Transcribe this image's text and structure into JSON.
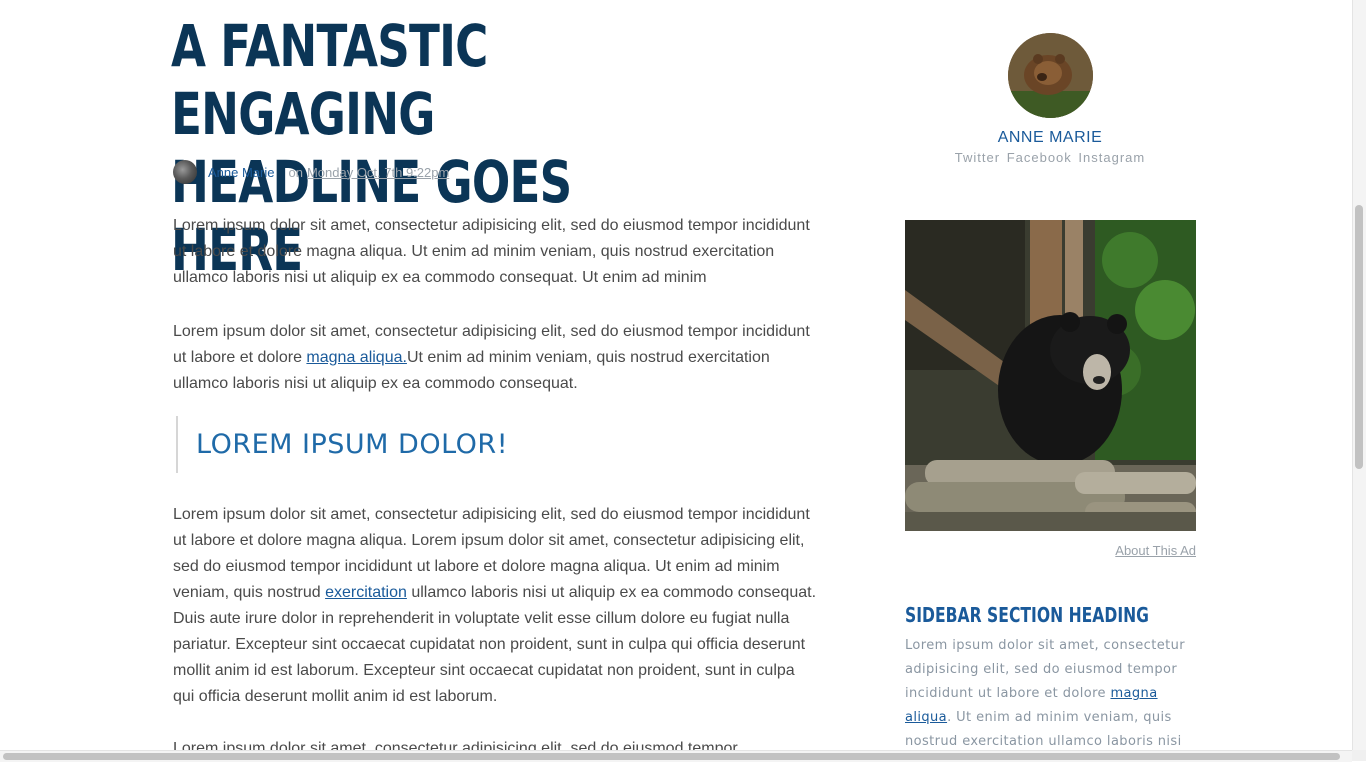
{
  "article": {
    "headline": "A FANTASTIC ENGAGING HEADLINE GOES HERE",
    "author": "Anne Marie",
    "on": "on",
    "date": "Monday Oct. 7th 9:22pm",
    "paragraph1": "Lorem ipsum dolor sit amet, consectetur adipisicing elit, sed do eiusmod tempor incididunt ut labore et dolore magna aliqua. Ut enim ad minim veniam, quis nostrud exercitation ullamco laboris nisi ut aliquip ex ea commodo consequat. Ut enim ad minim",
    "paragraph2": {
      "before": "Lorem ipsum dolor sit amet, consectetur adipisicing elit, sed do eiusmod tempor incididunt ut labore et dolore ",
      "link": "magna aliqua.",
      "after": "Ut enim ad minim veniam, quis nostrud exercitation ullamco laboris nisi ut aliquip ex ea commodo consequat."
    },
    "pullquote": "LOREM IPSUM DOLOR!",
    "paragraph3": {
      "before": "Lorem ipsum dolor sit amet, consectetur adipisicing elit, sed do eiusmod tempor incididunt ut labore et dolore magna aliqua. Lorem ipsum dolor sit amet, consectetur adipisicing elit, sed do eiusmod tempor incididunt ut labore et dolore magna aliqua. Ut enim ad minim veniam, quis nostrud ",
      "link": "exercitation",
      "after": " ullamco laboris nisi ut aliquip ex ea commodo consequat. Duis aute irure dolor in reprehenderit in voluptate velit esse cillum dolore eu fugiat nulla pariatur. Excepteur sint occaecat cupidatat non proident, sunt in culpa qui officia deserunt mollit anim id est laborum. Excepteur sint occaecat cupidatat non proident, sunt in culpa qui officia deserunt mollit anim id est laborum."
    },
    "paragraph4": "Lorem ipsum dolor sit amet, consectetur adipisicing elit, sed do eiusmod tempor"
  },
  "sidebar": {
    "profile_name": "ANNE MARIE",
    "social": [
      "Twitter",
      "Facebook",
      "Instagram"
    ],
    "ad_link": "About This Ad",
    "section_heading": "SIDEBAR SECTION HEADING",
    "section_text": {
      "before": "Lorem ipsum dolor sit amet, consectetur adipisicing elit, sed do eiusmod tempor incididunt ut labore et dolore ",
      "link": "magna aliqua",
      "after": ". Ut enim ad minim veniam, quis nostrud exercitation ullamco laboris nisi"
    }
  },
  "colors": {
    "headline": "#0b3556",
    "link": "#1a5a9a",
    "body_text": "#4a4a4a",
    "muted": "#9aa2aa"
  },
  "icons": [
    "author-avatar",
    "profile-avatar",
    "ad-image"
  ]
}
